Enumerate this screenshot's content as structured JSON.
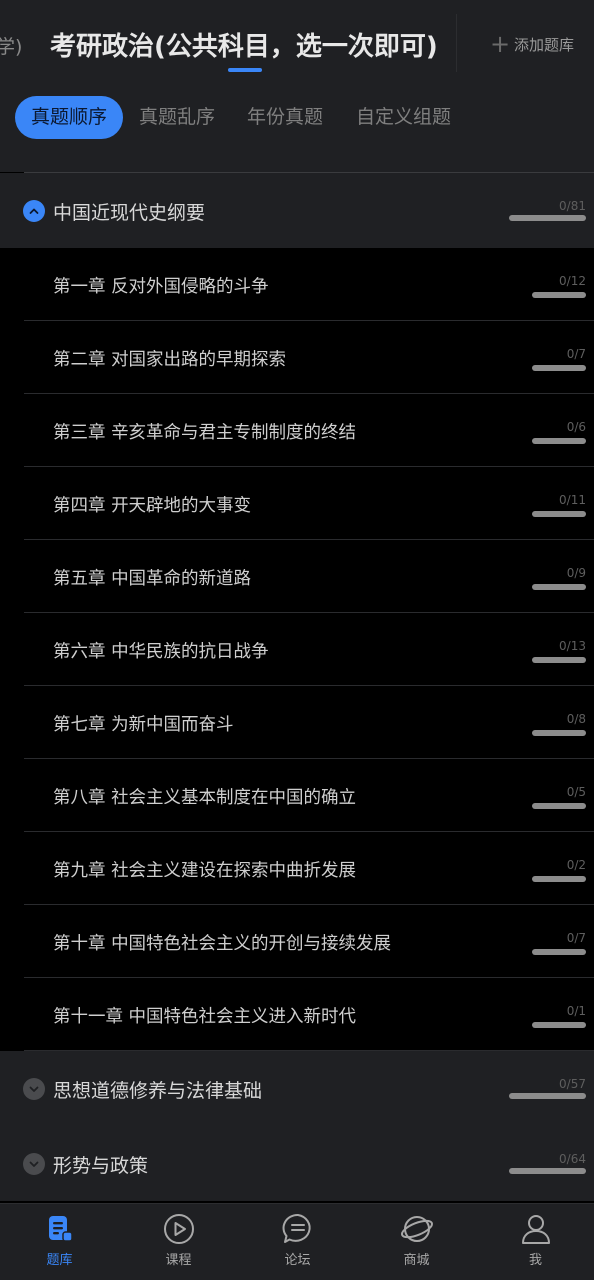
{
  "header": {
    "prev_tab_label": "学)",
    "active_tab_label": "考研政治(公共科目，选一次即可)",
    "add_bank_label": "添加题库"
  },
  "modes": [
    "真题顺序",
    "真题乱序",
    "年份真题",
    "自定义组题"
  ],
  "active_mode": "真题顺序",
  "subjects": [
    {
      "title": "中国近现代史纲要",
      "count": "0/81",
      "progress": 0,
      "expanded": true,
      "chapters": [
        {
          "title": "第一章 反对外国侵略的斗争",
          "count": "0/12",
          "progress": 0
        },
        {
          "title": "第二章 对国家出路的早期探索",
          "count": "0/7",
          "progress": 0
        },
        {
          "title": "第三章 辛亥革命与君主专制制度的终结",
          "count": "0/6",
          "progress": 0
        },
        {
          "title": "第四章 开天辟地的大事变",
          "count": "0/11",
          "progress": 0
        },
        {
          "title": "第五章 中国革命的新道路",
          "count": "0/9",
          "progress": 0
        },
        {
          "title": "第六章 中华民族的抗日战争",
          "count": "0/13",
          "progress": 0
        },
        {
          "title": "第七章 为新中国而奋斗",
          "count": "0/8",
          "progress": 0
        },
        {
          "title": "第八章 社会主义基本制度在中国的确立",
          "count": "0/5",
          "progress": 0
        },
        {
          "title": "第九章 社会主义建设在探索中曲折发展",
          "count": "0/2",
          "progress": 0
        },
        {
          "title": "第十章 中国特色社会主义的开创与接续发展",
          "count": "0/7",
          "progress": 0
        },
        {
          "title": "第十一章 中国特色社会主义进入新时代",
          "count": "0/1",
          "progress": 0
        }
      ]
    },
    {
      "title": "思想道德修养与法律基础",
      "count": "0/57",
      "progress": 0,
      "expanded": false,
      "chapters": []
    },
    {
      "title": "形势与政策",
      "count": "0/64",
      "progress": 0,
      "expanded": false,
      "chapters": []
    }
  ],
  "bottom_nav": [
    {
      "label": "题库",
      "icon": "question-bank-icon",
      "active": true
    },
    {
      "label": "课程",
      "icon": "play-circle-icon",
      "active": false
    },
    {
      "label": "论坛",
      "icon": "chat-bubble-icon",
      "active": false
    },
    {
      "label": "商城",
      "icon": "planet-icon",
      "active": false
    },
    {
      "label": "我",
      "icon": "person-icon",
      "active": false
    }
  ],
  "colors": {
    "accent": "#3a86f7",
    "panel": "#1f2023",
    "background": "#000000",
    "progress_track": "#8c8c8c"
  }
}
